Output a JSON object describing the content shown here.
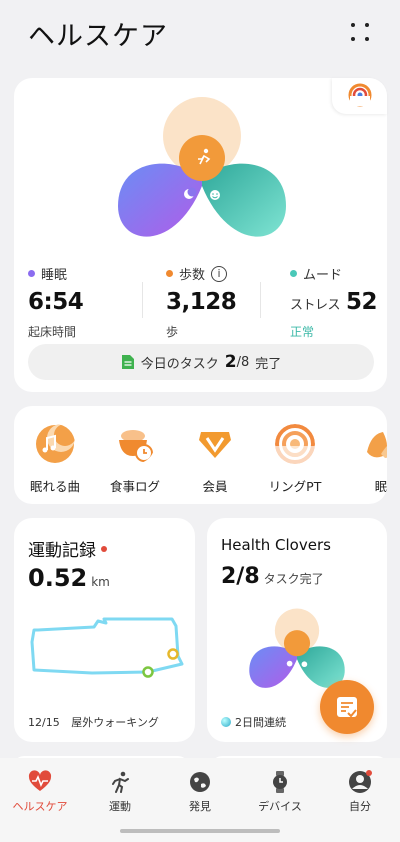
{
  "header": {
    "title": "ヘルスケア",
    "menu_icon": "grid-dots-icon"
  },
  "summary": {
    "sleep": {
      "label": "睡眠",
      "value": "6:54",
      "sub": "起床時間",
      "color": "#8b6cf0"
    },
    "steps": {
      "label": "歩数",
      "value": "3,128",
      "sub": "歩",
      "color": "#f0892f"
    },
    "mood": {
      "label": "ムード",
      "prefix": "ストレス",
      "value": "52",
      "sub": "正常",
      "sub_color": "#3bb8a7",
      "color": "#4ac8b8"
    },
    "task": {
      "label": "今日のタスク",
      "done": "2",
      "total": "/8",
      "suffix": "完了"
    }
  },
  "shortcuts": [
    {
      "label": "眠れる曲",
      "icon": "sleep-music-icon"
    },
    {
      "label": "食事ログ",
      "icon": "meal-log-icon"
    },
    {
      "label": "会員",
      "icon": "membership-icon"
    },
    {
      "label": "リングPT",
      "icon": "ring-pt-icon"
    },
    {
      "label": "眠",
      "icon": "sleep-icon"
    }
  ],
  "exercise": {
    "title": "運動記録",
    "value": "0.52",
    "unit": "km",
    "date": "12/15",
    "activity": "屋外ウォーキング"
  },
  "clovers": {
    "title": "Health Clovers",
    "value": "2/8",
    "unit": "タスク完了",
    "streak": "2日間連続"
  },
  "nav": [
    {
      "label": "ヘルスケア",
      "icon": "heart-pulse-icon",
      "active": true
    },
    {
      "label": "運動",
      "icon": "runner-icon"
    },
    {
      "label": "発見",
      "icon": "globe-icon"
    },
    {
      "label": "デバイス",
      "icon": "watch-icon"
    },
    {
      "label": "自分",
      "icon": "profile-icon"
    }
  ],
  "colors": {
    "accent": "#f0892f",
    "purple": "#8b6cf0",
    "teal": "#4ac8b8",
    "active_nav": "#e14b3b"
  }
}
